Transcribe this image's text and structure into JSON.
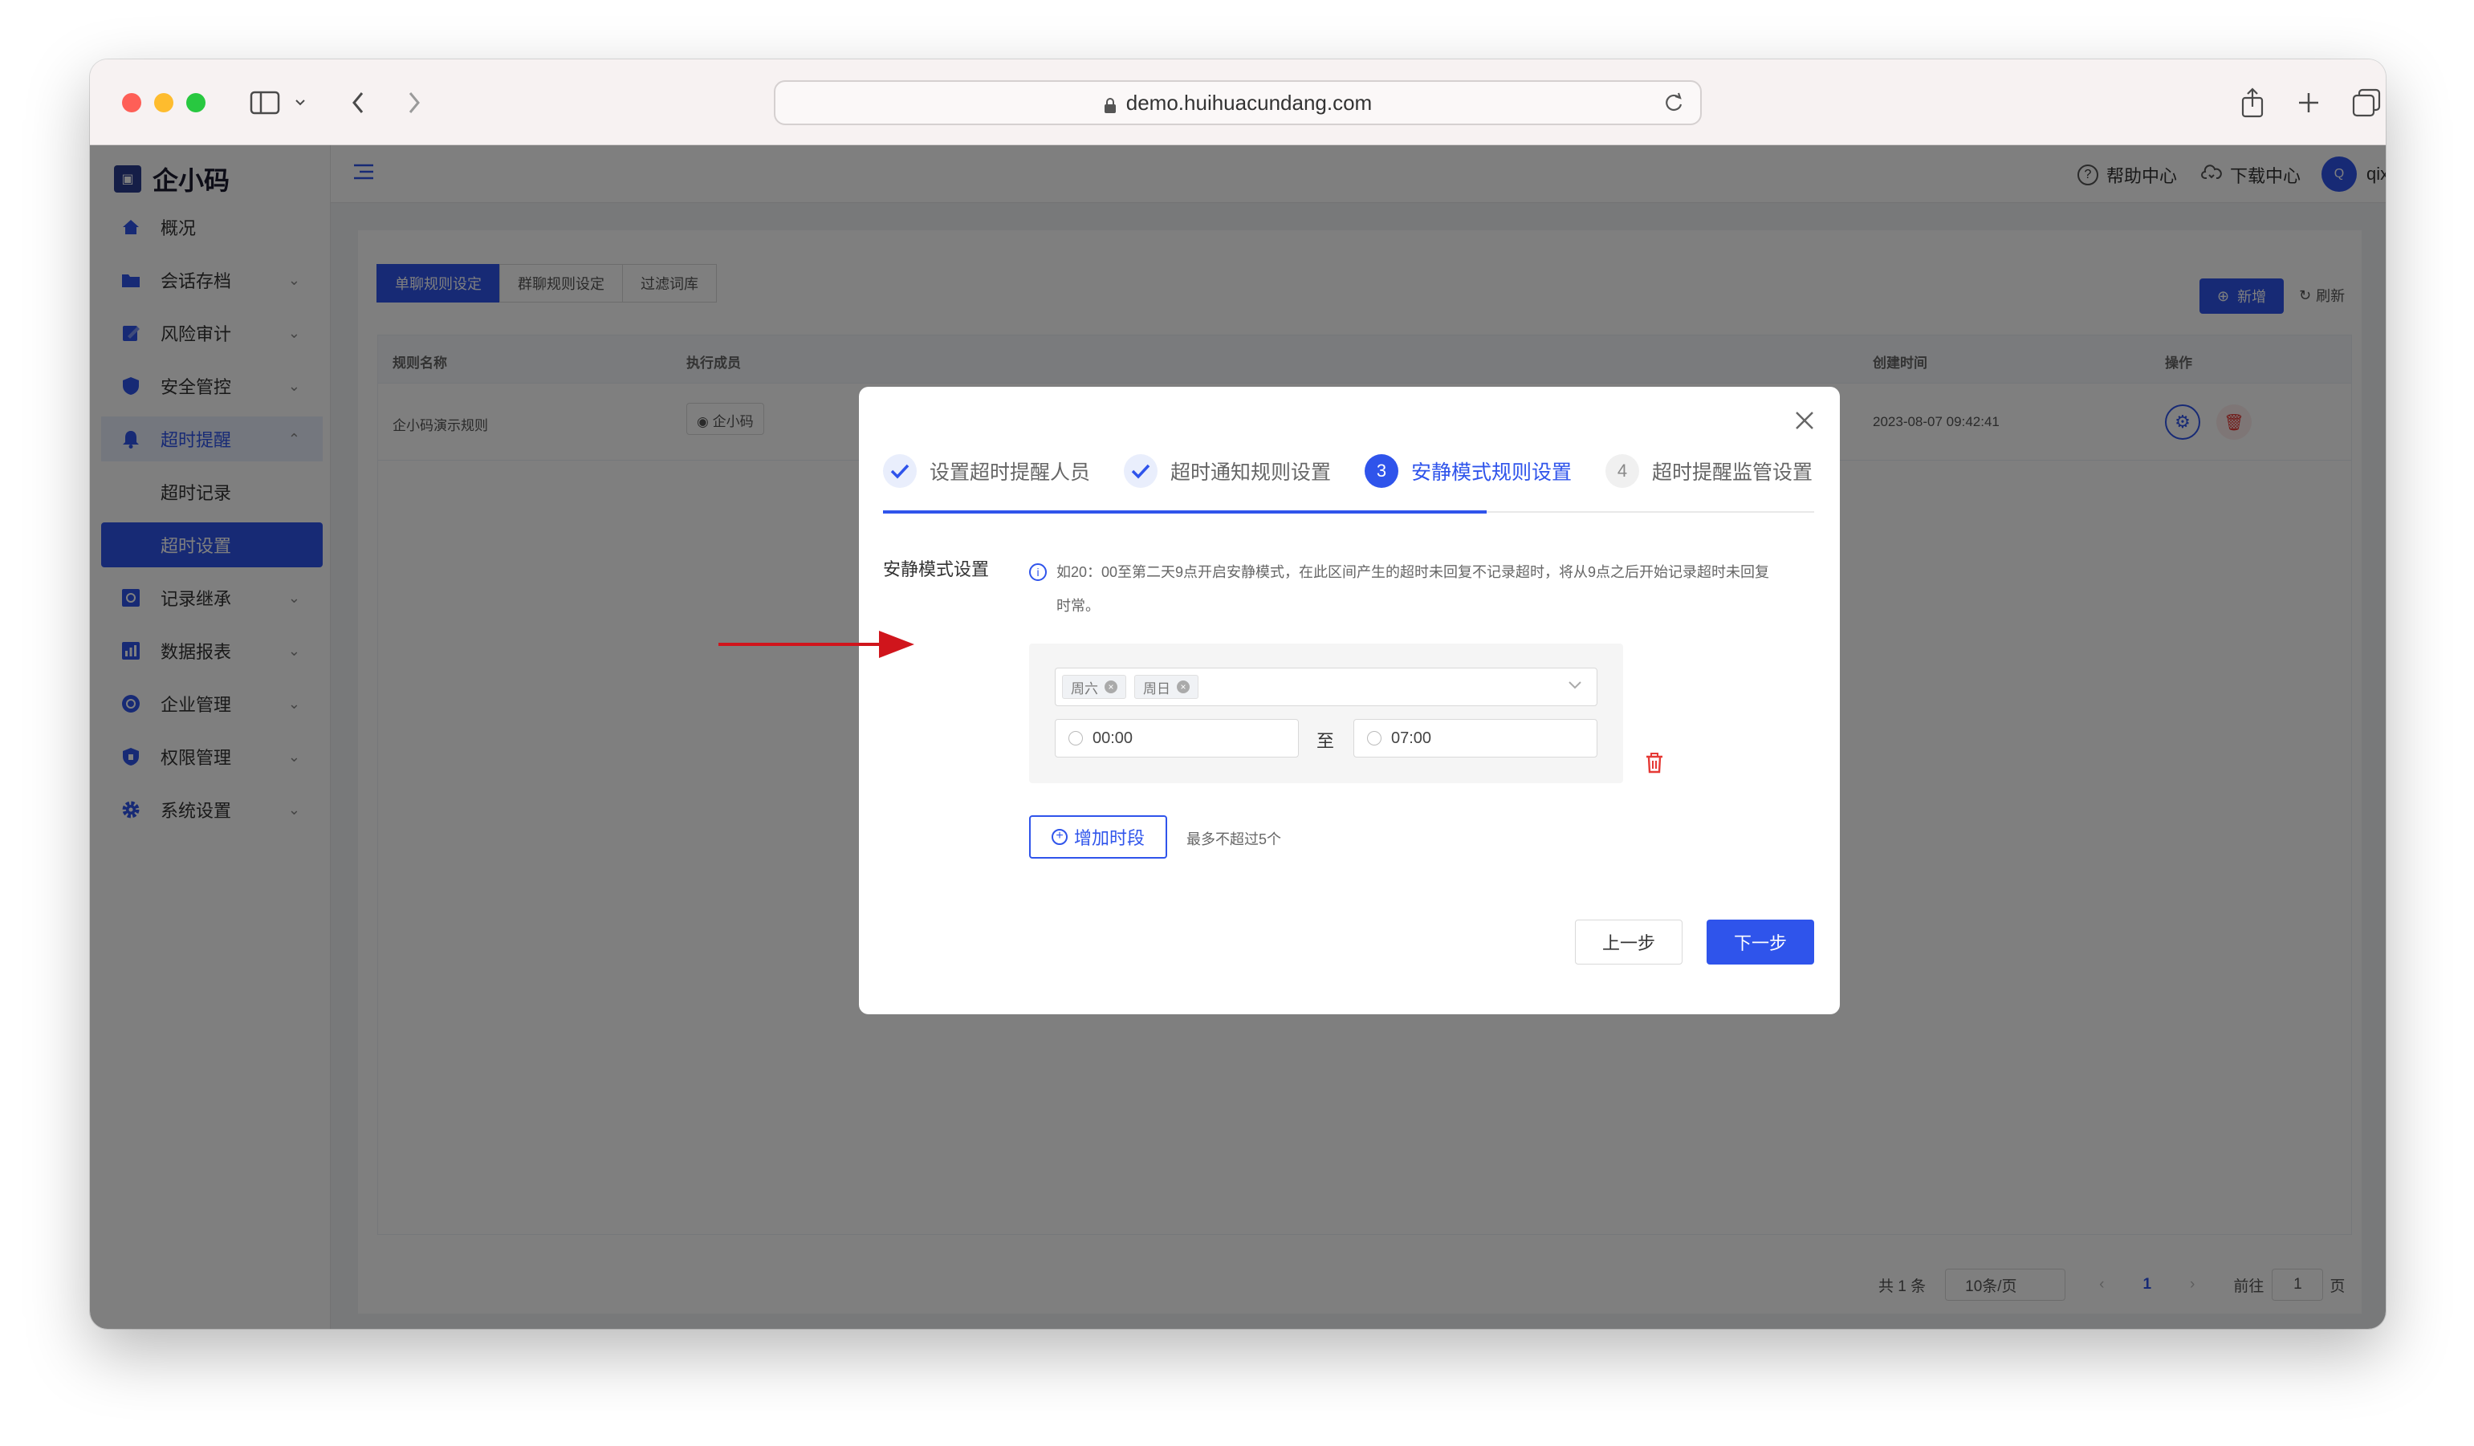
{
  "browser": {
    "url": "demo.huihuacundang.com"
  },
  "app": {
    "logo_text": "企小码"
  },
  "sidebar": {
    "items": [
      {
        "label": "概况",
        "icon": "home-icon"
      },
      {
        "label": "会话存档",
        "icon": "folder-icon"
      },
      {
        "label": "风险审计",
        "icon": "edit-icon"
      },
      {
        "label": "安全管控",
        "icon": "shield-icon"
      },
      {
        "label": "超时提醒",
        "icon": "bell-icon"
      },
      {
        "label": "超时记录"
      },
      {
        "label": "超时设置"
      },
      {
        "label": "记录继承",
        "icon": "inherit-icon"
      },
      {
        "label": "数据报表",
        "icon": "chart-icon"
      },
      {
        "label": "企业管理",
        "icon": "org-icon"
      },
      {
        "label": "权限管理",
        "icon": "lock-icon"
      },
      {
        "label": "系统设置",
        "icon": "gear-icon"
      }
    ]
  },
  "topbar": {
    "help": "帮助中心",
    "download": "下载中心",
    "username": "qixiaoma",
    "avatar_letter": "Q"
  },
  "tabs": [
    "单聊规则设定",
    "群聊规则设定",
    "过滤词库"
  ],
  "toolbar": {
    "add": "新增",
    "refresh": "刷新"
  },
  "table": {
    "headers": {
      "name": "规则名称",
      "members": "执行成员",
      "created": "创建时间",
      "actions": "操作"
    },
    "rows": [
      {
        "name": "企小码演示规则",
        "members": "企小码",
        "created": "2023-08-07 09:42:41"
      }
    ]
  },
  "pagination": {
    "total": "共 1 条",
    "page_size": "10条/页",
    "current": "1",
    "goto_prefix": "前往",
    "goto_value": "1",
    "goto_suffix": "页"
  },
  "dialog": {
    "steps": [
      {
        "label": "设置超时提醒人员",
        "state": "done"
      },
      {
        "label": "超时通知规则设置",
        "state": "done"
      },
      {
        "label": "安静模式规则设置",
        "state": "current",
        "num": "3"
      },
      {
        "label": "超时提醒监管设置",
        "state": "todo",
        "num": "4"
      }
    ],
    "field_label": "安静模式设置",
    "tip_line1": "如20：00至第二天9点开启安静模式，在此区间产生的超时未回复不记录超时，将从9点之后开始记录超时未回复",
    "tip_line2": "时常。",
    "period": {
      "days": [
        "周六",
        "周日"
      ],
      "start": "00:00",
      "separator": "至",
      "end": "07:00"
    },
    "add_button": "增加时段",
    "hint": "最多不超过5个",
    "prev": "上一步",
    "next": "下一步"
  },
  "colors": {
    "primary": "#2f54eb",
    "danger": "#e53935",
    "annotation_arrow": "#d0151c"
  }
}
